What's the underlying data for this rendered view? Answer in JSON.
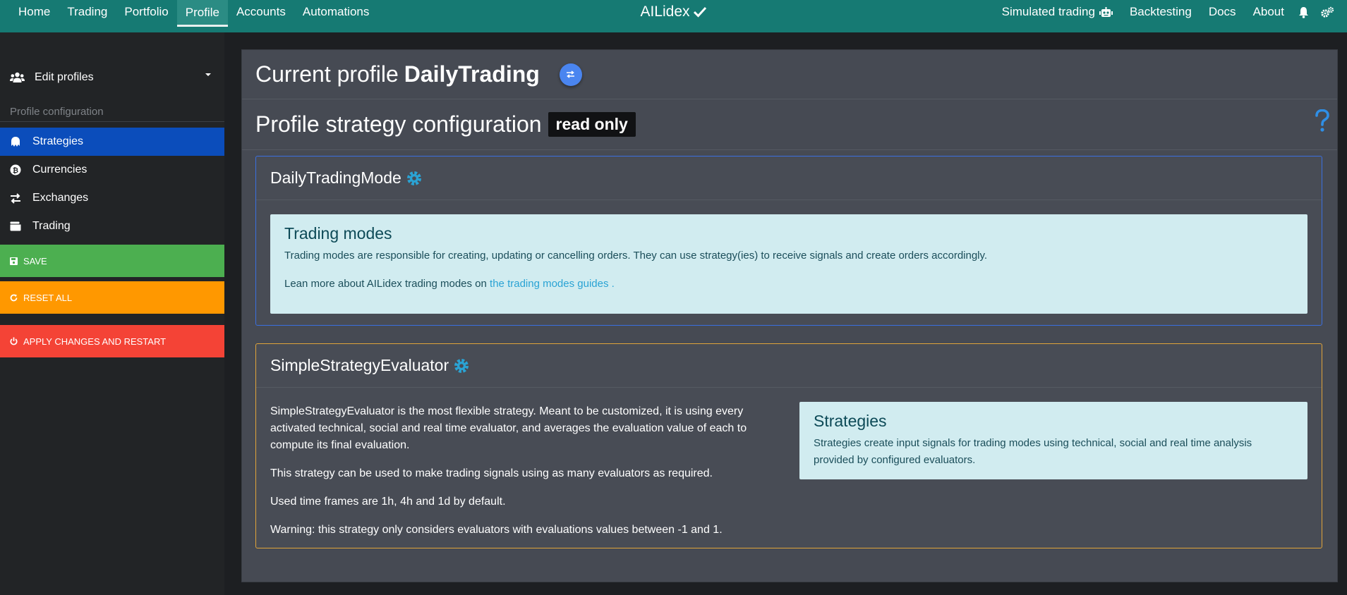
{
  "nav": {
    "left": [
      "Home",
      "Trading",
      "Portfolio",
      "Profile",
      "Accounts",
      "Automations"
    ],
    "active_index": 3,
    "brand": "AILidex",
    "right": [
      "Simulated trading",
      "Backtesting",
      "Docs",
      "About"
    ]
  },
  "sidebar": {
    "edit_profiles": "Edit profiles",
    "section_title": "Profile configuration",
    "items": [
      {
        "label": "Strategies",
        "icon": "strategy-icon"
      },
      {
        "label": "Currencies",
        "icon": "bitcoin-icon"
      },
      {
        "label": "Exchanges",
        "icon": "exchange-icon"
      },
      {
        "label": "Trading",
        "icon": "wallet-icon"
      }
    ],
    "active_index": 0,
    "save_label": "SAVE",
    "reset_label": "RESET ALL",
    "apply_label": "APPLY CHANGES AND RESTART"
  },
  "main": {
    "current_profile_prefix": "Current profile",
    "current_profile_name": "DailyTrading",
    "strategy_title": "Profile strategy configuration",
    "read_only_badge": "read only",
    "trading_mode_card": {
      "title": "DailyTradingMode",
      "info_title": "Trading modes",
      "info_text": "Trading modes are responsible for creating, updating or cancelling orders. They can use strategy(ies) to receive signals and create orders accordingly.",
      "info_more_prefix": "Lean more about AILidex trading modes on",
      "info_more_link": "the trading modes guides",
      "info_more_suffix": "."
    },
    "strategy_card": {
      "title": "SimpleStrategyEvaluator",
      "description": [
        "SimpleStrategyEvaluator is the most flexible strategy. Meant to be customized, it is using every activated technical, social and real time evaluator, and averages the evaluation value of each to compute its final evaluation.",
        "This strategy can be used to make trading signals using as many evaluators as required.",
        "Used time frames are 1h, 4h and 1d by default.",
        "Warning: this strategy only considers evaluators with evaluations values between -1 and 1."
      ],
      "info_title": "Strategies",
      "info_text": "Strategies create input signals for trading modes using technical, social and real time analysis provided by configured evaluators."
    }
  },
  "colors": {
    "navbar": "#167a73",
    "active_side": "#0b4dbb",
    "save": "#4caf50",
    "reset": "#ff9800",
    "apply": "#f44336"
  }
}
